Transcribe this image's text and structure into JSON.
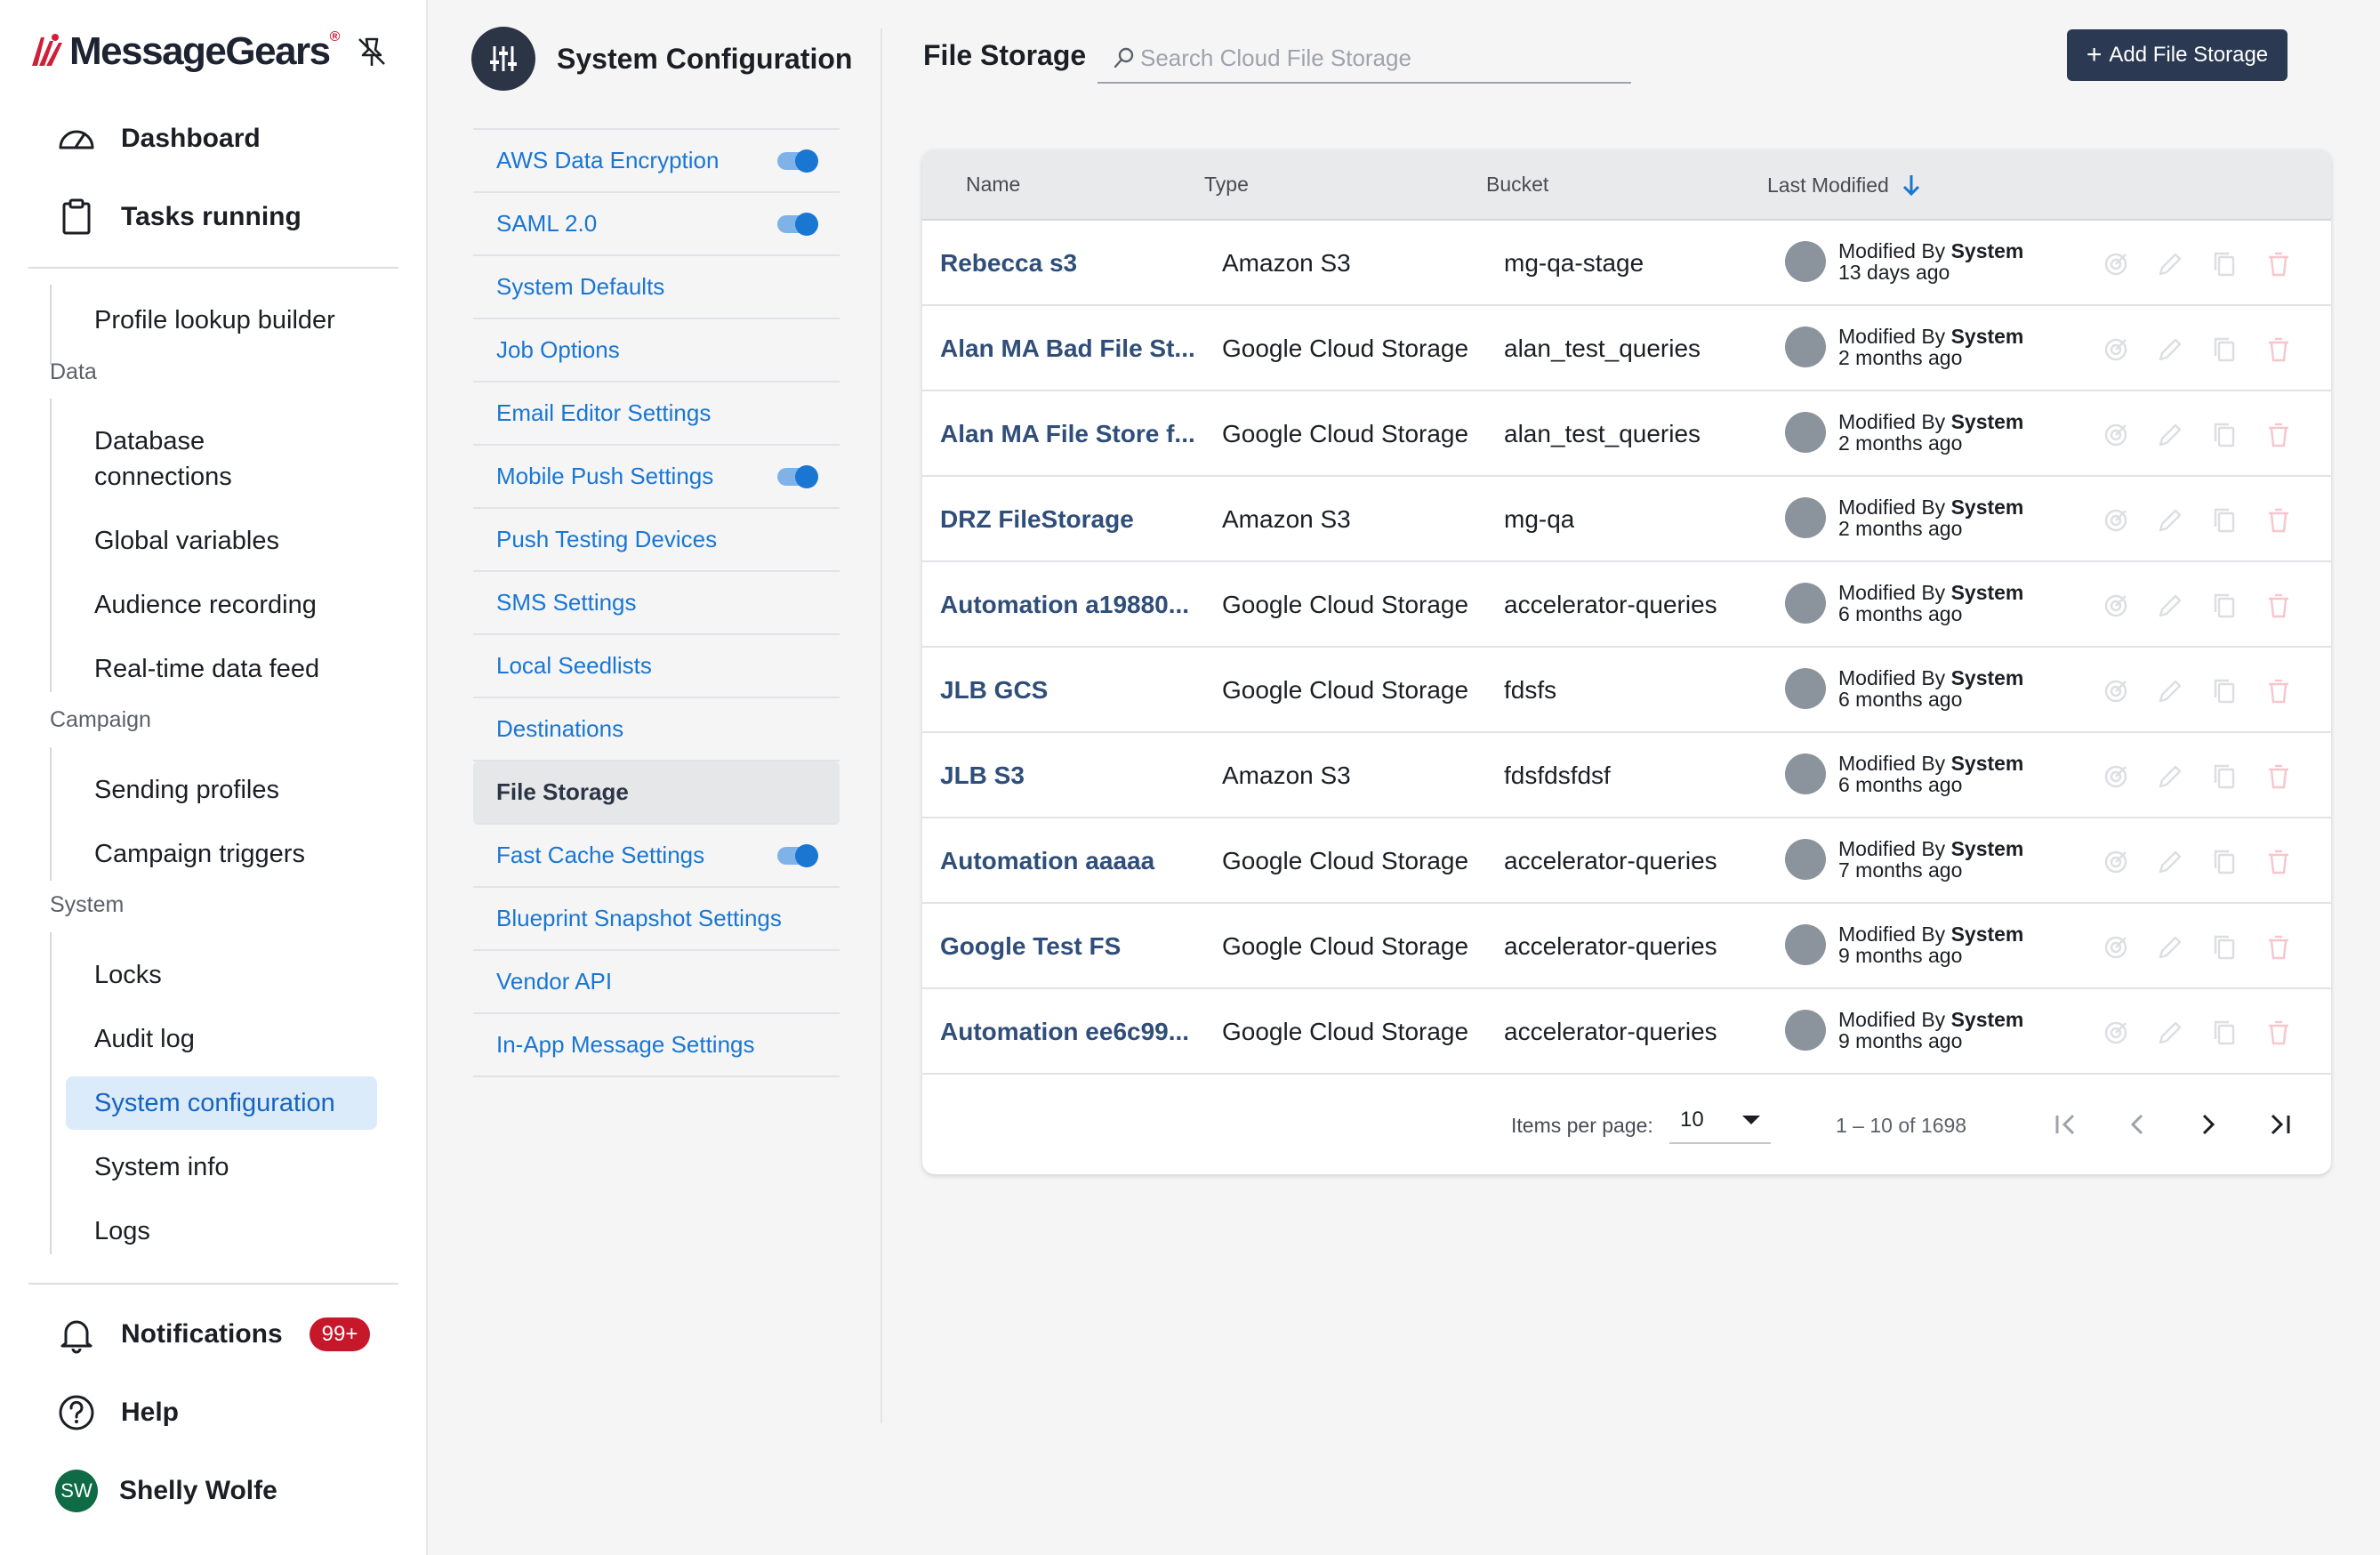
{
  "brand": {
    "name": "MessageGears",
    "tm": "®"
  },
  "nav": {
    "top": [
      {
        "label": "Dashboard",
        "icon": "gauge-icon"
      },
      {
        "label": "Tasks running",
        "icon": "clipboard-icon"
      }
    ],
    "profile_lookup": "Profile lookup builder",
    "sections": {
      "data": {
        "title": "Data",
        "items": [
          "Database connections",
          "Global variables",
          "Audience recording",
          "Real-time data feed"
        ]
      },
      "campaign": {
        "title": "Campaign",
        "items": [
          "Sending profiles",
          "Campaign triggers"
        ]
      },
      "system": {
        "title": "System",
        "items": [
          "Locks",
          "Audit log",
          "System configuration",
          "System info",
          "Logs"
        ]
      }
    },
    "bottom": {
      "notifications": {
        "label": "Notifications",
        "badge": "99+"
      },
      "help": {
        "label": "Help"
      },
      "user": {
        "initials": "SW",
        "name": "Shelly Wolfe"
      }
    }
  },
  "config": {
    "title": "System Configuration",
    "items": [
      {
        "label": "AWS Data Encryption",
        "toggle": true
      },
      {
        "label": "SAML 2.0",
        "toggle": true
      },
      {
        "label": "System Defaults",
        "toggle": false
      },
      {
        "label": "Job Options",
        "toggle": false
      },
      {
        "label": "Email Editor Settings",
        "toggle": false
      },
      {
        "label": "Mobile Push Settings",
        "toggle": true
      },
      {
        "label": "Push Testing Devices",
        "toggle": false
      },
      {
        "label": "SMS Settings",
        "toggle": false
      },
      {
        "label": "Local Seedlists",
        "toggle": false
      },
      {
        "label": "Destinations",
        "toggle": false
      },
      {
        "label": "File Storage",
        "toggle": false,
        "active": true
      },
      {
        "label": "Fast Cache Settings",
        "toggle": true
      },
      {
        "label": "Blueprint Snapshot Settings",
        "toggle": false
      },
      {
        "label": "Vendor API",
        "toggle": false
      },
      {
        "label": "In-App Message Settings",
        "toggle": false
      }
    ]
  },
  "main": {
    "title": "File Storage",
    "search_placeholder": "Search Cloud File Storage",
    "add_button": "Add File Storage",
    "columns": {
      "name": "Name",
      "type": "Type",
      "bucket": "Bucket",
      "modified": "Last Modified"
    },
    "rows": [
      {
        "name": "Rebecca s3",
        "type": "Amazon S3",
        "bucket": "mg-qa-stage",
        "by": "System",
        "ago": "13 days ago"
      },
      {
        "name": "Alan MA Bad File St...",
        "type": "Google Cloud Storage",
        "bucket": "alan_test_queries",
        "by": "System",
        "ago": "2 months ago"
      },
      {
        "name": "Alan MA File Store f...",
        "type": "Google Cloud Storage",
        "bucket": "alan_test_queries",
        "by": "System",
        "ago": "2 months ago"
      },
      {
        "name": "DRZ FileStorage",
        "type": "Amazon S3",
        "bucket": "mg-qa",
        "by": "System",
        "ago": "2 months ago"
      },
      {
        "name": "Automation a19880...",
        "type": "Google Cloud Storage",
        "bucket": "accelerator-queries",
        "by": "System",
        "ago": "6 months ago"
      },
      {
        "name": "JLB GCS",
        "type": "Google Cloud Storage",
        "bucket": "fdsfs",
        "by": "System",
        "ago": "6 months ago"
      },
      {
        "name": "JLB S3",
        "type": "Amazon S3",
        "bucket": "fdsfdsfdsf",
        "by": "System",
        "ago": "6 months ago"
      },
      {
        "name": "Automation aaaaa",
        "type": "Google Cloud Storage",
        "bucket": "accelerator-queries",
        "by": "System",
        "ago": "7 months ago"
      },
      {
        "name": "Google Test FS",
        "type": "Google Cloud Storage",
        "bucket": "accelerator-queries",
        "by": "System",
        "ago": "9 months ago"
      },
      {
        "name": "Automation ee6c99...",
        "type": "Google Cloud Storage",
        "bucket": "accelerator-queries",
        "by": "System",
        "ago": "9 months ago"
      }
    ],
    "modified_prefix": "Modified By",
    "pager": {
      "items_per_page_label": "Items per page:",
      "items_per_page": "10",
      "range": "1 – 10 of 1698"
    }
  },
  "colors": {
    "accent": "#1976d2",
    "primary_button": "#2b3a52",
    "brand_red": "#d11f3a",
    "badge": "#c6172b",
    "active_nav_bg": "#dcebfa"
  }
}
